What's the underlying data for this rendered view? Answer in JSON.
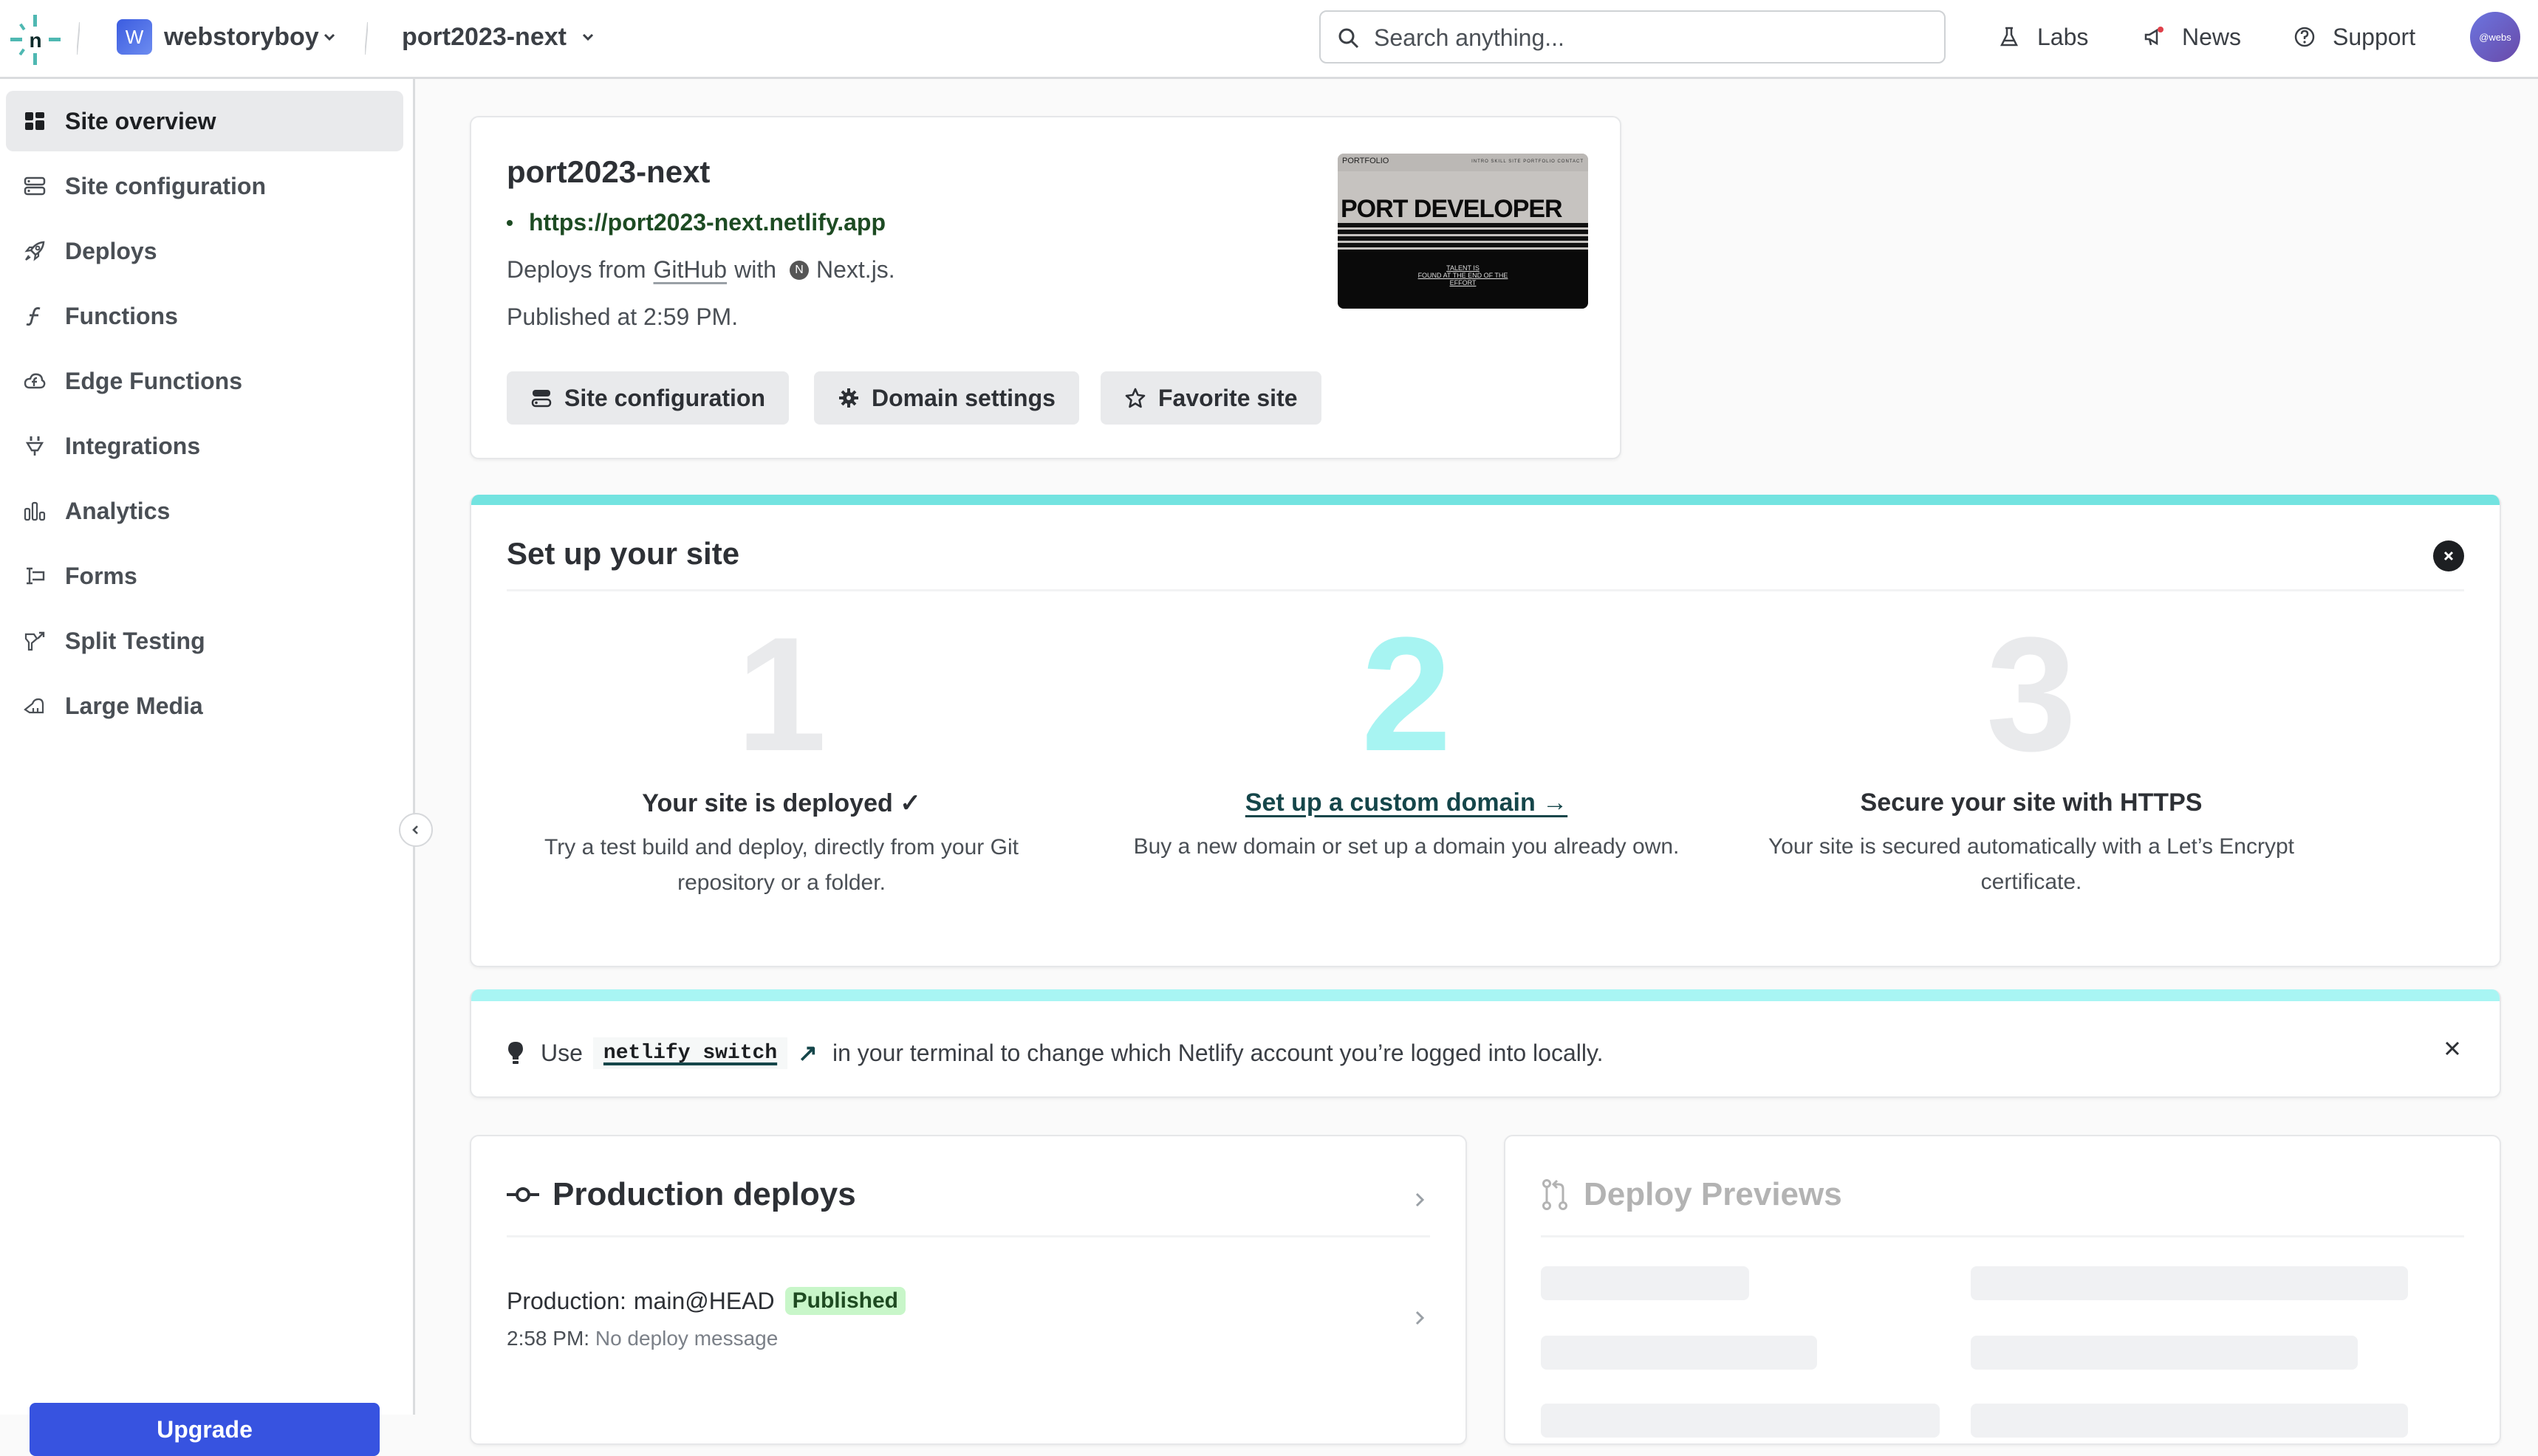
{
  "topbar": {
    "logo": "netlify-logo",
    "team": {
      "initial": "W",
      "name": "webstoryboy"
    },
    "site": {
      "name": "port2023-next"
    },
    "search": {
      "placeholder": "Search anything..."
    },
    "links": [
      {
        "label": "Labs",
        "icon": "flask-icon"
      },
      {
        "label": "News",
        "icon": "megaphone-icon",
        "has_notification": true
      },
      {
        "label": "Support",
        "icon": "help-circle-icon"
      }
    ],
    "avatar": {
      "label": "@webs"
    }
  },
  "sidebar": {
    "items": [
      {
        "label": "Site overview",
        "icon": "dashboard-icon",
        "active": true
      },
      {
        "label": "Site configuration",
        "icon": "server-config-icon"
      },
      {
        "label": "Deploys",
        "icon": "rocket-icon"
      },
      {
        "label": "Functions",
        "icon": "function-icon"
      },
      {
        "label": "Edge Functions",
        "icon": "cloud-function-icon"
      },
      {
        "label": "Integrations",
        "icon": "plug-icon"
      },
      {
        "label": "Analytics",
        "icon": "bar-chart-icon"
      },
      {
        "label": "Forms",
        "icon": "form-icon"
      },
      {
        "label": "Split Testing",
        "icon": "split-icon"
      },
      {
        "label": "Large Media",
        "icon": "large-media-icon"
      }
    ],
    "upgrade_label": "Upgrade"
  },
  "site_card": {
    "title": "port2023-next",
    "url": "https://port2023-next.netlify.app",
    "deploys_prefix": "Deploys from",
    "deploys_source": "GitHub",
    "deploys_with": "with",
    "framework_icon_letter": "N",
    "framework": "Next.js.",
    "published": "Published at 2:59 PM.",
    "buttons": [
      {
        "label": "Site configuration",
        "icon": "server-config-icon"
      },
      {
        "label": "Domain settings",
        "icon": "gear-icon"
      },
      {
        "label": "Favorite site",
        "icon": "star-icon"
      }
    ],
    "thumbnail": {
      "brand": "PORTFOLIO",
      "nav": "INTRO  SKILL  SITE  PORTFOLIO  CONTACT",
      "hero": "PORT DEVELOPER",
      "tagline": [
        "TALENT IS",
        "FOUND AT THE END OF THE",
        "EFFORT"
      ]
    }
  },
  "setup": {
    "title": "Set up your site",
    "steps": [
      {
        "number": "1",
        "title": "Your site is deployed ✓",
        "description": "Try a test build and deploy, directly from your Git repository or a folder.",
        "active": false
      },
      {
        "number": "2",
        "title": "Set up a custom domain →",
        "description": "Buy a new domain or set up a domain you already own.",
        "active": true
      },
      {
        "number": "3",
        "title": "Secure your site with HTTPS",
        "description": "Your site is secured automatically with a Let’s Encrypt certificate.",
        "active": false
      }
    ]
  },
  "tip": {
    "prefix": "Use",
    "command": "netlify switch",
    "arrow": "↗",
    "suffix": "in your terminal to change which Netlify account you’re logged into locally."
  },
  "production_deploys": {
    "title": "Production deploys",
    "row": {
      "label": "Production:",
      "branch": "main@HEAD",
      "status": "Published",
      "time": "2:58 PM:",
      "message": "No deploy message"
    }
  },
  "deploy_previews": {
    "title": "Deploy Previews"
  },
  "colors": {
    "accent_teal": "#73e3e0",
    "upgrade_blue": "#3753e0",
    "published_badge_bg": "#c8f6c9",
    "link_green": "#1d4b23"
  }
}
